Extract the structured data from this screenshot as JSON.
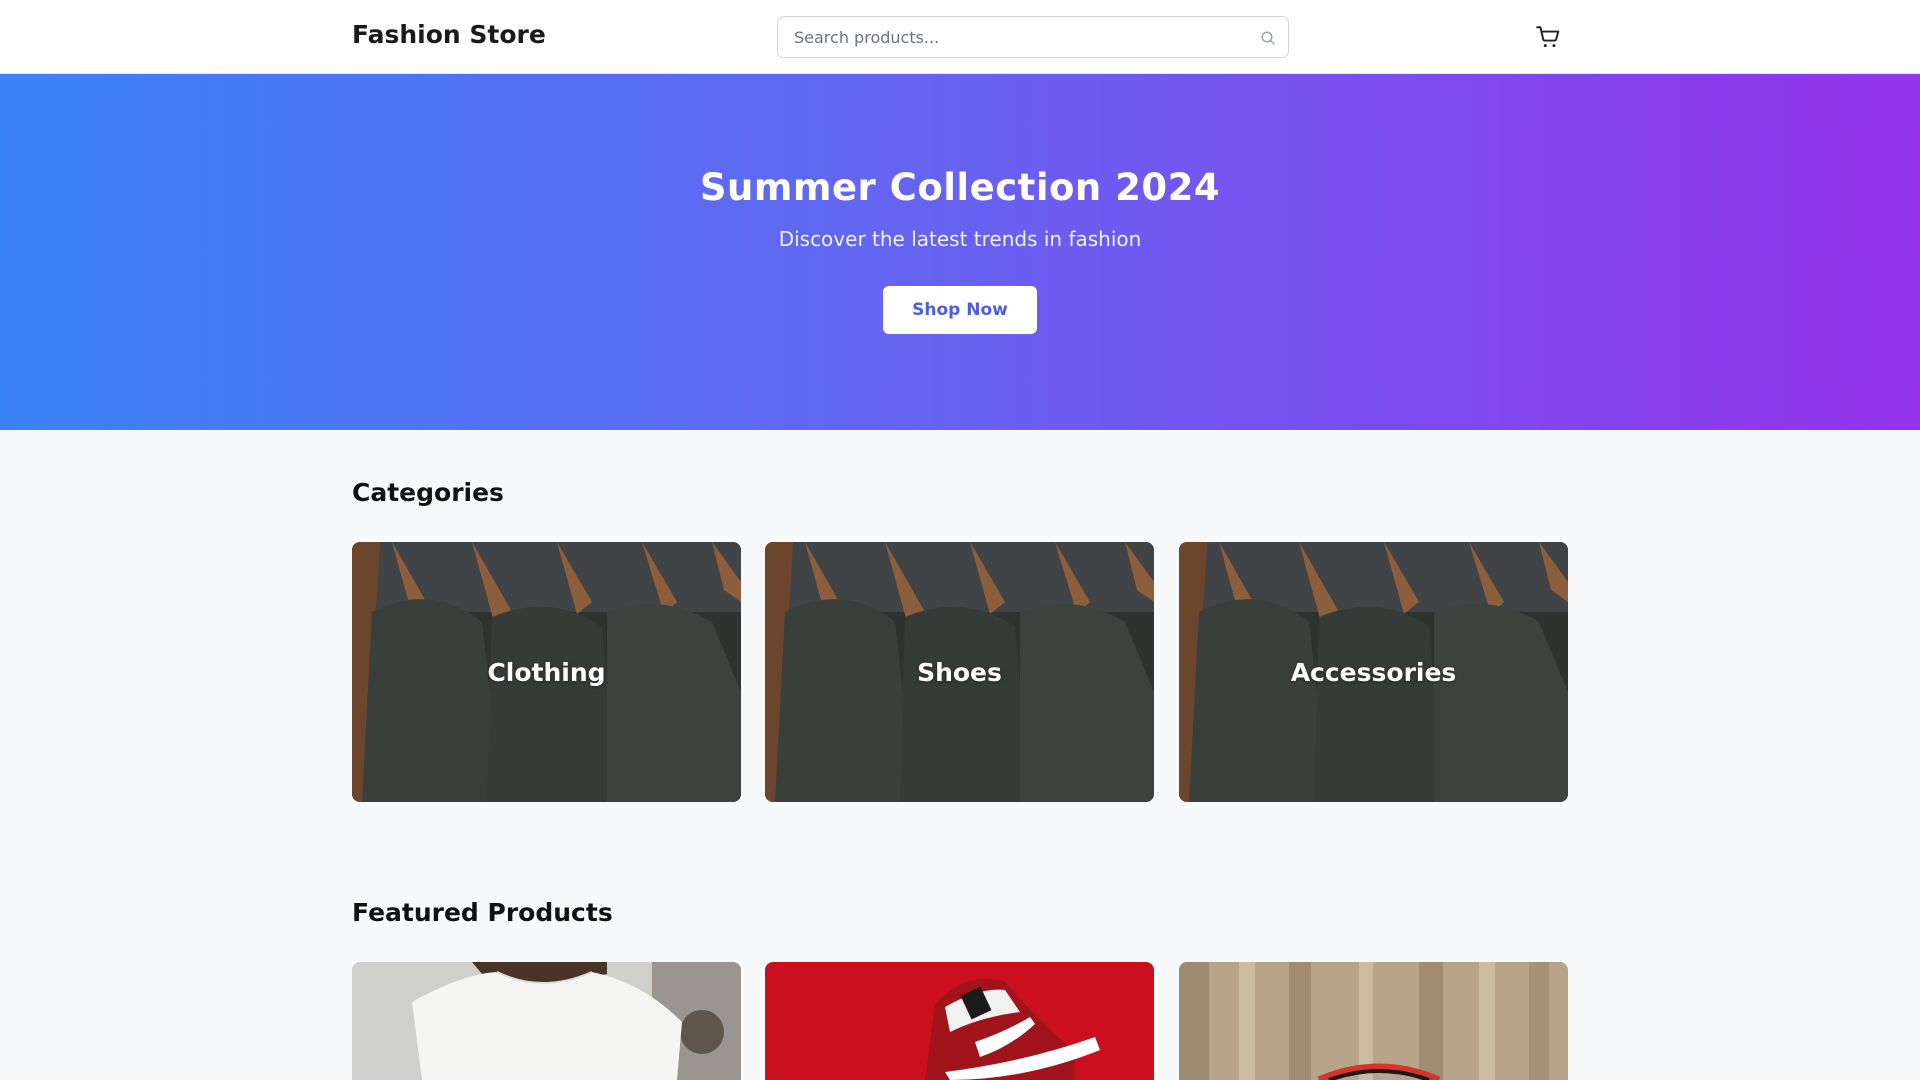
{
  "header": {
    "logo": "Fashion Store",
    "search_placeholder": "Search products...",
    "search_icon": "search-icon",
    "cart_icon": "cart-icon"
  },
  "hero": {
    "title": "Summer Collection 2024",
    "subtitle": "Discover the latest trends in fashion",
    "cta_label": "Shop Now",
    "gradient_colors": [
      "#3b82f6",
      "#6366f1",
      "#9333ea"
    ]
  },
  "categories": {
    "title": "Categories",
    "items": [
      {
        "label": "Clothing"
      },
      {
        "label": "Shoes"
      },
      {
        "label": "Accessories"
      }
    ]
  },
  "featured": {
    "title": "Featured Products"
  },
  "colors": {
    "accent": "#4a5ee0",
    "page_background": "#f8f9fb"
  }
}
